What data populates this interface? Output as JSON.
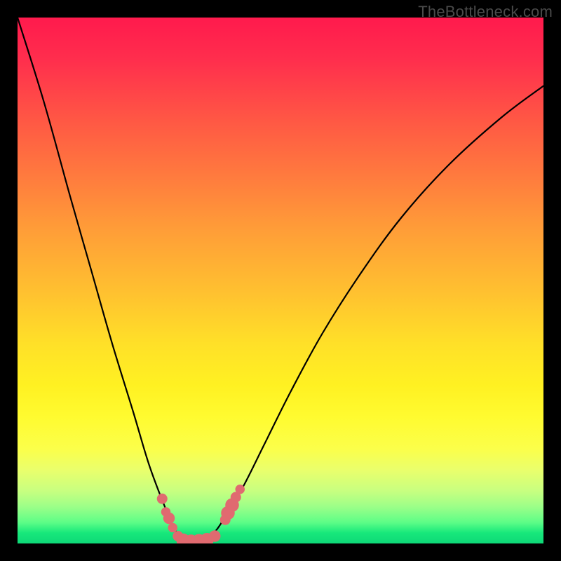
{
  "watermark": "TheBottleneck.com",
  "gradient": {
    "top": "#ff1a4d",
    "mid": "#fff122",
    "bottom": "#0ed877"
  },
  "chart_data": {
    "type": "line",
    "title": "",
    "xlabel": "",
    "ylabel": "",
    "xlim": [
      0,
      100
    ],
    "ylim": [
      0,
      100
    ],
    "note": "V-shaped bottleneck curve; values approximate the black line trajectory. Touches zero near x≈33. Dots cluster near the trough.",
    "series": [
      {
        "name": "bottleneck-curve",
        "x": [
          0,
          5,
          10,
          14,
          18,
          22,
          25,
          28,
          30,
          32,
          34,
          36,
          38,
          40,
          43,
          47,
          52,
          58,
          65,
          73,
          82,
          92,
          100
        ],
        "y": [
          100,
          84,
          66,
          52,
          38,
          25,
          15,
          7,
          2.5,
          0.5,
          0.3,
          0.8,
          2.8,
          6,
          11,
          19,
          29,
          40,
          51,
          62,
          72,
          81,
          87
        ]
      }
    ],
    "dots": {
      "name": "trough-markers",
      "color": "#e06a70",
      "points": [
        {
          "x": 27.5,
          "y": 8.5,
          "r": 1.0
        },
        {
          "x": 28.2,
          "y": 6.0,
          "r": 0.9
        },
        {
          "x": 28.8,
          "y": 4.8,
          "r": 1.1
        },
        {
          "x": 29.5,
          "y": 3.0,
          "r": 0.9
        },
        {
          "x": 30.5,
          "y": 1.4,
          "r": 1.0
        },
        {
          "x": 31.5,
          "y": 0.6,
          "r": 1.3
        },
        {
          "x": 33.0,
          "y": 0.4,
          "r": 1.3
        },
        {
          "x": 34.5,
          "y": 0.5,
          "r": 1.3
        },
        {
          "x": 36.0,
          "y": 0.7,
          "r": 1.3
        },
        {
          "x": 37.5,
          "y": 1.4,
          "r": 1.1
        },
        {
          "x": 39.5,
          "y": 4.5,
          "r": 1.0
        },
        {
          "x": 40.0,
          "y": 5.8,
          "r": 1.3
        },
        {
          "x": 40.8,
          "y": 7.3,
          "r": 1.3
        },
        {
          "x": 41.5,
          "y": 8.8,
          "r": 1.0
        },
        {
          "x": 42.3,
          "y": 10.3,
          "r": 0.9
        }
      ]
    }
  }
}
